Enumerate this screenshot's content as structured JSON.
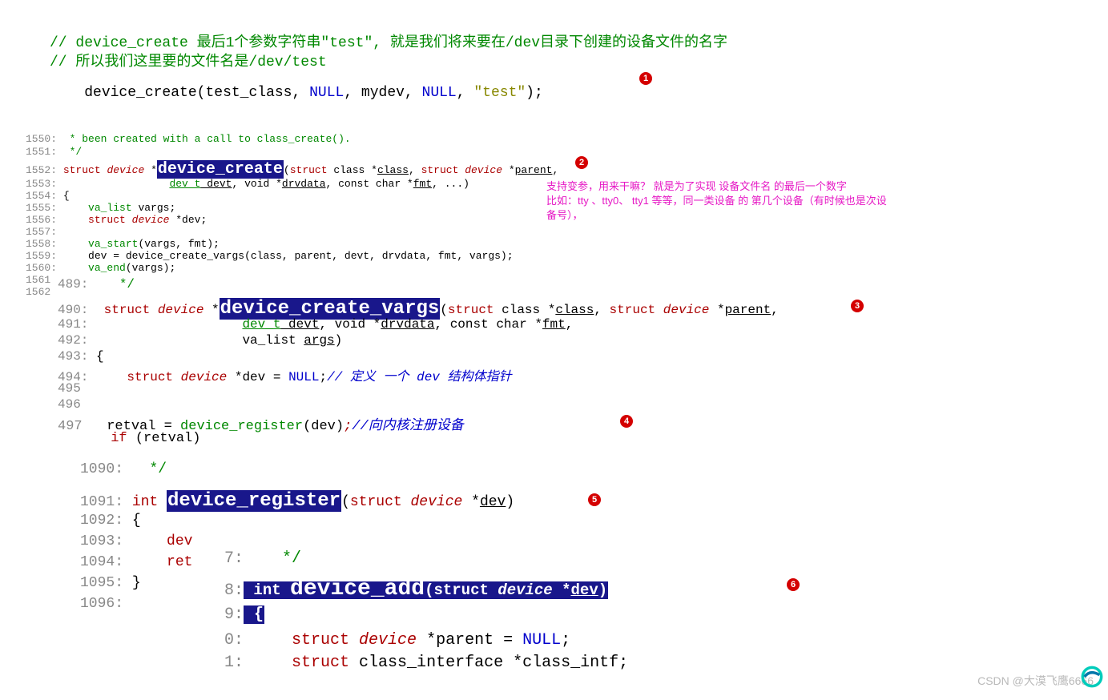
{
  "top": {
    "c1": "// device_create 最后1个参数字符串\"test\", 就是我们将来要在/dev目录下创建的设备文件的名字",
    "c2": "// 所以我们这里要的文件名是/dev/test",
    "call_fn": "device_create",
    "call_args_open": "(",
    "call_args": "test_class, ",
    "call_null1": "NULL",
    "call_sep1": ", mydev, ",
    "call_null2": "NULL",
    "call_sep2": ", ",
    "call_str": "\"test\"",
    "call_close": ");"
  },
  "blk1": {
    "l1550_no": "1550:",
    "l1550": " * been created with a call to class_create().",
    "l1551_no": "1551:",
    "l1551": " */",
    "l1552_no": "1552:",
    "l1552_pre": "struct",
    "l1552_dev": " device ",
    "l1552_star": "*",
    "l1552_fn": "device_create",
    "l1552_post1": "(",
    "l1552_struct1": "struct",
    "l1552_post2": " class *",
    "l1552_class": "class",
    "l1552_post3": ", ",
    "l1552_struct2": "struct",
    "l1552_post4": " ",
    "l1552_dev2": "device",
    "l1552_post5": " *",
    "l1552_parent": "parent",
    "l1552_post6": ",",
    "l1553_no": "1553:",
    "l1553_devt": "dev_t",
    "l1553_devt2": " devt",
    "l1553_void": ", void *",
    "l1553_drv": "drvdata",
    "l1553_cc": ", const char *",
    "l1553_fmt": "fmt",
    "l1553_end": ", ...)",
    "l1554_no": "1554:",
    "l1554": "{",
    "l1555_no": "1555:",
    "l1555_a": "    va_list",
    "l1555_b": " vargs;",
    "l1556_no": "1556:",
    "l1556_a": "    struct",
    "l1556_b": " device",
    "l1556_c": " *dev;",
    "l1557_no": "1557:",
    "l1558_no": "1558:",
    "l1558_a": "    va_start",
    "l1558_b": "(vargs, fmt);",
    "l1559_no": "1559:",
    "l1559_a": "    dev = ",
    "l1559_b": "device_create_vargs",
    "l1559_c": "(class, parent, devt, drvdata, fmt, vargs);",
    "l1560_no": "1560:",
    "l1560_a": "    va_end",
    "l1560_b": "(vargs);",
    "l1561_no": "1561",
    "l1562_no": "1562"
  },
  "blk2": {
    "l489_no": "489:",
    "l489": "   */",
    "l490_no": "490:",
    "l490_struct": "struct",
    "l490_dev": " device ",
    "l490_star": "*",
    "l490_fn": "device_create_vargs",
    "l490_open": "(",
    "l490_s1": "struct",
    "l490_c1": " class *",
    "l490_class": "class",
    "l490_c2": ", ",
    "l490_s2": "struct",
    "l490_c3": " ",
    "l490_dev2": "device",
    "l490_c4": " *",
    "l490_parent": "parent",
    "l490_c5": ",",
    "l491_no": "491:",
    "l491_devt": "dev_t",
    "l491_devt2": " devt",
    "l491_void": ", void *",
    "l491_drv": "drvdata",
    "l491_cc": ", const char *",
    "l491_fmt": "fmt",
    "l491_end": ",",
    "l492_no": "492:",
    "l492_a": "va_list ",
    "l492_b": "args",
    "l492_c": ")",
    "l493_no": "493:",
    "l493": " {",
    "l494_no": "494:",
    "l494_a": "    struct",
    "l494_b": " device",
    "l494_c": " *dev = ",
    "l494_d": "NULL",
    "l494_e": ";",
    "l494_cm": "// 定义 一个 dev 结构体指针",
    "l495_no": "495",
    "l496_no": "496",
    "l497_no": "497",
    "l497_a": " retval = ",
    "l497_fn": "device_register",
    "l497_c": "(dev)",
    "l497_d": ";",
    "l497_cm": "//向内核注册设备",
    "if_line": " if ",
    "if_b": "(retval)"
  },
  "blk3": {
    "l1090_no": "1090:",
    "l1090": "  */",
    "l1091_no": "1091:",
    "l1091_int": " int ",
    "l1091_fn": "device_register",
    "l1091_open": "(",
    "l1091_s": "struct",
    "l1091_d": " device ",
    "l1091_star": "*",
    "l1091_dev": "dev",
    "l1091_close": ")",
    "l1092_no": "1092:",
    "l1092": " {",
    "l1093_no": "1093:",
    "l1093": "     dev",
    "l1094_no": "1094:",
    "l1094": "     ret",
    "l1095_no": "1095:",
    "l1095": " }",
    "l1096_no": "1096:"
  },
  "blk4": {
    "l7_no": "7:",
    "l7": "   */",
    "l8_no": "8:",
    "l8_int": " int ",
    "l8_fn": "device_add",
    "l8_open": "(",
    "l8_s": "struct",
    "l8_d": " device ",
    "l8_star": "*",
    "l8_dev": "dev",
    "l8_close": ")",
    "l9_no": "9:",
    "l9": " {",
    "l10_no": "0:",
    "l10_a": "     struct",
    "l10_b": " device",
    "l10_c": " *parent = ",
    "l10_d": "NULL",
    "l10_e": ";",
    "l11_no": "1:",
    "l11_a": "     struct",
    "l11_b": " class_interface *class_intf;"
  },
  "annotation": {
    "line1": "支持变参，用来干嘛？ 就是为了实现 设备文件名 的最后一个数字",
    "line2": "比如：tty 、tty0、 tty1 等等，同一类设备 的 第几个设备（有时候也是次设备号），"
  },
  "badges": {
    "b1": "1",
    "b2": "2",
    "b3": "3",
    "b4": "4",
    "b5": "5",
    "b6": "6"
  },
  "watermark": "CSDN @大漠飞鹰6666"
}
